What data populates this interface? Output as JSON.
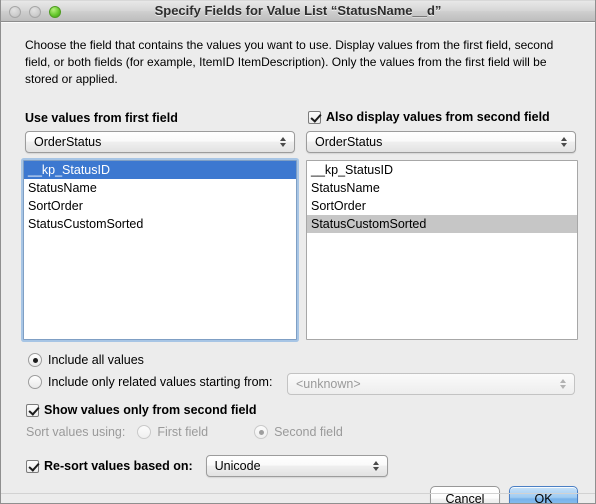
{
  "window": {
    "title": "Specify Fields for Value List “StatusName__d”",
    "traffic_lights": [
      "close-button",
      "minimize-button",
      "zoom-button"
    ]
  },
  "instructions": "Choose the field that contains the values you want to use.  Display values from the first field, second field, or both fields (for example, ItemID ItemDescription). Only the values from the first field will be stored or applied.",
  "first_field": {
    "label": "Use values from first field",
    "selected_table": "OrderStatus",
    "fields": [
      "__kp_StatusID",
      "StatusName",
      "SortOrder",
      "StatusCustomSorted"
    ],
    "selected_field": "__kp_StatusID",
    "selected_index": 0
  },
  "second_field": {
    "checkbox_label": "Also display values from second field",
    "checkbox_checked": true,
    "selected_table": "OrderStatus",
    "fields": [
      "__kp_StatusID",
      "StatusName",
      "SortOrder",
      "StatusCustomSorted"
    ],
    "selected_field": "StatusCustomSorted",
    "selected_index": 3
  },
  "options": {
    "include_all_label": "Include all values",
    "include_all_selected": true,
    "include_related_label": "Include only related values starting from:",
    "include_related_selected": false,
    "related_from_value": "<unknown>",
    "related_from_enabled": false,
    "show_second_only_label": "Show values only from second field",
    "show_second_only_checked": true,
    "sort_values_label": "Sort values using:",
    "sort_first_label": "First field",
    "sort_second_label": "Second field",
    "sort_selected": "Second field",
    "sort_enabled": false,
    "resort_label": "Re-sort values based on:",
    "resort_checked": true,
    "resort_value": "Unicode"
  },
  "buttons": {
    "cancel": "Cancel",
    "ok": "OK"
  },
  "colors": {
    "selection_active": "#3c78d0",
    "selection_inactive": "#c6c6c6",
    "default_button": "#9fcbf2",
    "focus_ring": "#70a5e0",
    "window_bg": "#ececec"
  }
}
